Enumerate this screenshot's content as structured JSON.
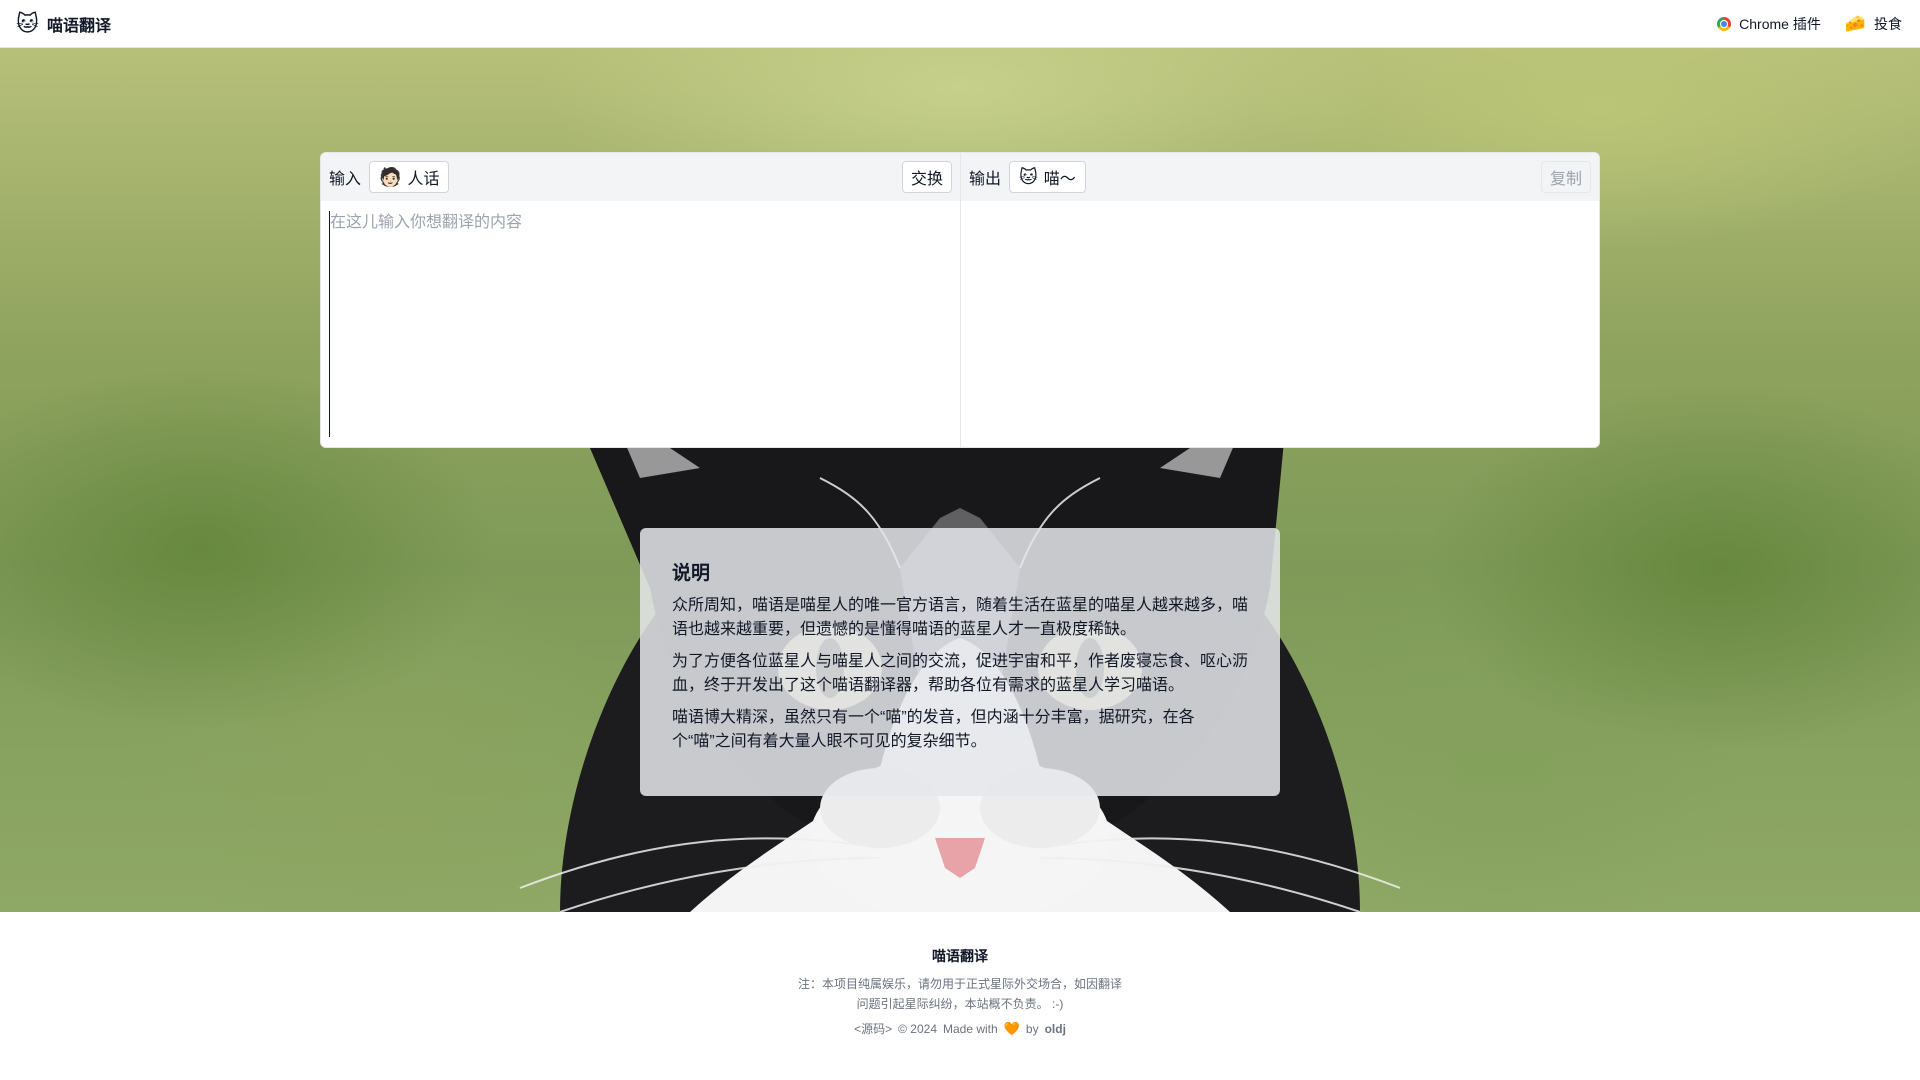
{
  "app": {
    "logo_emoji": "🐱",
    "title": "喵语翻译"
  },
  "nav": {
    "chrome_plugin": "Chrome 插件",
    "feed_emoji": "🧀",
    "feed": "投食"
  },
  "translator": {
    "input": {
      "label": "输入",
      "lang_emoji": "🧑🏻",
      "lang": "人话",
      "swap_label": "交换",
      "placeholder": "在这儿输入你想翻译的内容",
      "value": ""
    },
    "output": {
      "label": "输出",
      "lang_emoji": "🐱",
      "lang": "喵～",
      "copy_label": "复制",
      "value": ""
    }
  },
  "explanation": {
    "title": "说明",
    "paragraphs": [
      "众所周知，喵语是喵星人的唯一官方语言，随着生活在蓝星的喵星人越来越多，喵语也越来越重要，但遗憾的是懂得喵语的蓝星人才一直极度稀缺。",
      "为了方便各位蓝星人与喵星人之间的交流，促进宇宙和平，作者废寝忘食、呕心沥血，终于开发出了这个喵语翻译器，帮助各位有需求的蓝星人学习喵语。",
      "喵语博大精深，虽然只有一个“喵”的发音，但内涵十分丰富，据研究，在各个“喵”之间有着大量人眼不可见的复杂细节。"
    ]
  },
  "footer": {
    "title": "喵语翻译",
    "note": "注：本项目纯属娱乐，请勿用于正式星际外交场合，如因翻译问题引起星际纠纷，本站概不负责。 :-)",
    "source_link": "<源码>",
    "copyright": "© 2024",
    "made_with": "Made with",
    "heart": "🧡",
    "by": "by",
    "author": "oldj"
  },
  "colors": {
    "accent_heart": "#f97316",
    "panel_header_bg": "#f3f4f6",
    "muted_text": "#6b7280"
  }
}
